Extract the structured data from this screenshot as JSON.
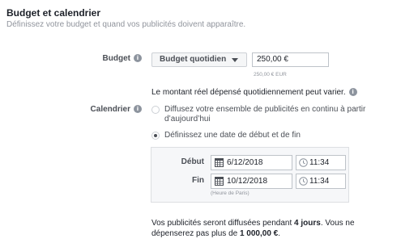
{
  "section": {
    "title": "Budget et calendrier",
    "subtitle": "Définissez votre budget et quand vos publicités doivent apparaître."
  },
  "budget": {
    "label": "Budget",
    "info_icon": "info-icon",
    "type_selected": "Budget quotidien",
    "amount": "250,00 €",
    "amount_small": "250,00 € EUR",
    "note": "Le montant réel dépensé quotidiennement peut varier."
  },
  "schedule": {
    "label": "Calendrier",
    "options": [
      {
        "label": "Diffusez votre ensemble de publicités en continu à partir d’aujourd’hui",
        "selected": false
      },
      {
        "label": "Définissez une date de début et de fin",
        "selected": true
      }
    ],
    "start": {
      "label": "Début",
      "date": "6/12/2018",
      "time": "11:34"
    },
    "end": {
      "label": "Fin",
      "date": "10/12/2018",
      "time": "11:34"
    },
    "timezone": "(Heure de Paris)"
  },
  "summary": {
    "part1": "Vos publicités seront diffusées pendant ",
    "days": "4 jours",
    "part2": ". Vous ne dépenserez pas plus de ",
    "total": "1 000,00 €",
    "part3": "."
  }
}
